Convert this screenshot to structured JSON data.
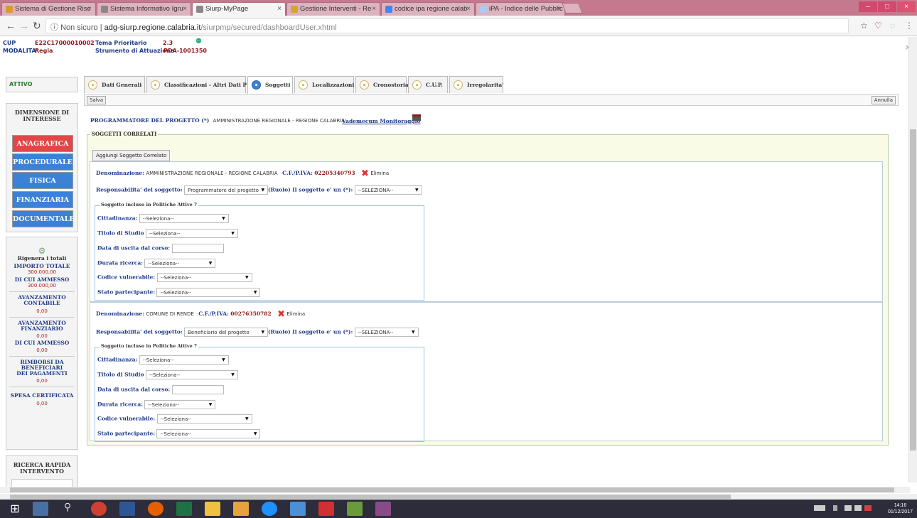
{
  "browser": {
    "tabs": [
      {
        "title": "Sistema di Gestione Risc",
        "color": "#d89b2b"
      },
      {
        "title": "Sistema Informativo Igru",
        "color": "#bbbbbb"
      },
      {
        "title": "Siurp-MyPage",
        "color": "#bbbbbb"
      },
      {
        "title": "Gestione Interventi - Re",
        "color": "#d8a52b"
      },
      {
        "title": "codice ipa regione calab",
        "color": "#4285f4"
      },
      {
        "title": "iPA - Indice delle Pubblic",
        "color": "#aaccee"
      }
    ],
    "active_tab": 2,
    "window_controls": {
      "minimize": "–",
      "maximize": "□",
      "close": "×"
    },
    "security_label": "Non sicuro",
    "url_host": "adg-siurp.regione.calabria.it",
    "url_path": "/siurpmp/secured/dashboardUser.xhtml"
  },
  "header": {
    "cup_label": "CUP",
    "cup_value": "E22C17000010002",
    "tema_label": "Tema Prioritario",
    "tema_value": "2.3",
    "modalita_label": "MODALITA'",
    "modalita_value": "Regia",
    "strumento_label": "Strumento di Attuazione",
    "strumento_value": "PDA-1001350",
    "close": "×"
  },
  "sidebar": {
    "status": "ATTIVO",
    "dimension_title": "DIMENSIONE DI INTERESSE",
    "nav": [
      {
        "label": "ANAGRAFICA",
        "style": "red"
      },
      {
        "label": "PROCEDURALE",
        "style": "blue"
      },
      {
        "label": "FISICA",
        "style": "blue"
      },
      {
        "label": "FINANZIARIA",
        "style": "blue"
      },
      {
        "label": "DOCUMENTALE",
        "style": "blue"
      }
    ],
    "rigenera": "Rigenera i totali",
    "importo_totale_label": "IMPORTO TOTALE",
    "importo_totale_value": "300.000,00",
    "di_cui_ammesso_label": "DI CUI AMMESSO",
    "di_cui_ammesso_value": "300.000,00",
    "avanzamento_contabile_label": "AVANZAMENTO CONTABILE",
    "avanzamento_contabile_value": "0,00",
    "avanzamento_finanziario_label": "AVANZAMENTO FINANZIARIO",
    "avanzamento_finanziario_value": "0,00",
    "di_cui_ammesso2_label": "DI CUI AMMESSO",
    "di_cui_ammesso2_value": "0,00",
    "rimborsi_label": "RIMBORSI DA BENEFICIARI DEI PAGAMENTI",
    "rimborsi_value": "0,00",
    "spesa_label": "SPESA CERTIFICATA",
    "spesa_value": "0,00",
    "ricerca_title": "RICERCA RAPIDA INTERVENTO"
  },
  "main": {
    "tabs": [
      {
        "label": "Dati Generali"
      },
      {
        "label": "Classificazioni - Altri Dati PUC"
      },
      {
        "label": "Soggetti"
      },
      {
        "label": "Localizzazioni"
      },
      {
        "label": "Cronostoria"
      },
      {
        "label": "C.U.P."
      },
      {
        "label": "Irregolarita'"
      }
    ],
    "active_tab": 2,
    "salva": "Salva",
    "annulla": "Annulla",
    "programmatore_label": "PROGRAMMATORE DEL PROGETTO (*)",
    "programmatore_value": "AMMINISTRAZIONE REGIONALE - REGIONE CALABRIA",
    "vademecum": "Vademecum Monitoraggio",
    "soggetti_legend": "SOGGETTI CORRELATI",
    "add_button": "Aggiungi Soggetto Correlato",
    "labels": {
      "denominazione": "Denominazione:",
      "cf": "C.F./P.IVA:",
      "elimina": "Elimina",
      "responsabilita": "Responsabilita' del soggetto:",
      "ruolo": "(Ruolo) Il soggetto e' un (*):",
      "politiche": "Soggetto incluso in Politiche Attive ?",
      "cittadinanza": "Cittadinanza:",
      "titolo": "Titolo di Studio",
      "data_uscita": "Data di uscita dal corso:",
      "durata": "Durata ricerca:",
      "codice_vuln": "Codice vulnerabile:",
      "stato": "Stato partecipante:"
    },
    "soggetti": [
      {
        "denominazione": "AMMINISTRAZIONE REGIONALE - REGIONE CALABRIA",
        "cf": "02205340793",
        "responsabilita": "Programmatore del progetto",
        "ruolo": "--SELEZIONA--",
        "cittadinanza": "--Seleziona--",
        "titolo": "--Seleziona--",
        "data_uscita": "",
        "durata": "--Seleziona--",
        "codice_vuln": "--Seleziona--",
        "stato": "--Seleziona--"
      },
      {
        "denominazione": "COMUNE DI RENDE",
        "cf": "00276350782",
        "responsabilita": "Beneficiario del progetto",
        "ruolo": "--SELEZIONA--",
        "cittadinanza": "--Seleziona--",
        "titolo": "--Seleziona--",
        "data_uscita": "",
        "durata": "--Seleziona--",
        "codice_vuln": "--Seleziona--",
        "stato": "--Seleziona--"
      }
    ]
  },
  "taskbar": {
    "time": "14:16",
    "date": "01/12/2017"
  }
}
